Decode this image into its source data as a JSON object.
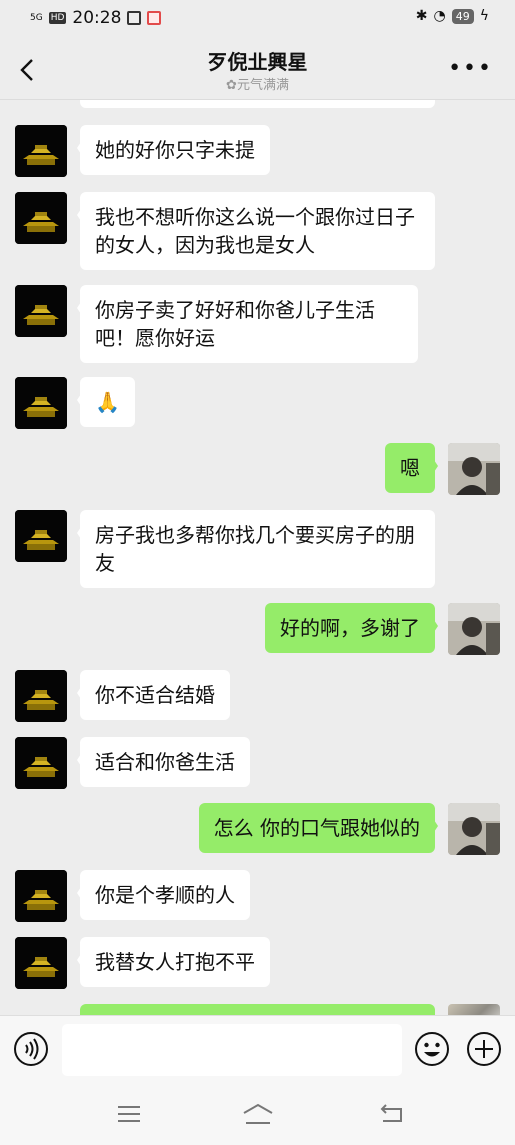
{
  "status": {
    "signal": "5G",
    "hd": "HD",
    "time": "20:28",
    "battery": "49"
  },
  "header": {
    "title": "歹倪㐀興星",
    "subtitle": "元气满满"
  },
  "messages": [
    {
      "from": "other",
      "text": "她的好你只字未提"
    },
    {
      "from": "other",
      "text": "我也不想听你这么说一个跟你过日子的女人，因为我也是女人"
    },
    {
      "from": "other",
      "text": "你房子卖了好好和你爸儿子生活吧！愿你好运"
    },
    {
      "from": "other",
      "text": "🙏"
    },
    {
      "from": "me",
      "text": "嗯"
    },
    {
      "from": "other",
      "text": "房子我也多帮你找几个要买房子的朋友"
    },
    {
      "from": "me",
      "text": "好的啊，多谢了"
    },
    {
      "from": "other",
      "text": "你不适合结婚"
    },
    {
      "from": "other",
      "text": "适合和你爸生活"
    },
    {
      "from": "me",
      "text": "怎么 你的口气跟她似的"
    },
    {
      "from": "other",
      "text": "你是个孝顺的人"
    },
    {
      "from": "other",
      "text": "我替女人打抱不平"
    }
  ],
  "colors": {
    "my_bubble": "#95ec69",
    "their_bubble": "#ffffff",
    "background": "#ededed"
  },
  "icons": {
    "back": "chevron-left-icon",
    "more": "more-dots-icon",
    "voice": "voice-icon",
    "emoji": "emoji-icon",
    "add": "plus-circle-icon"
  }
}
